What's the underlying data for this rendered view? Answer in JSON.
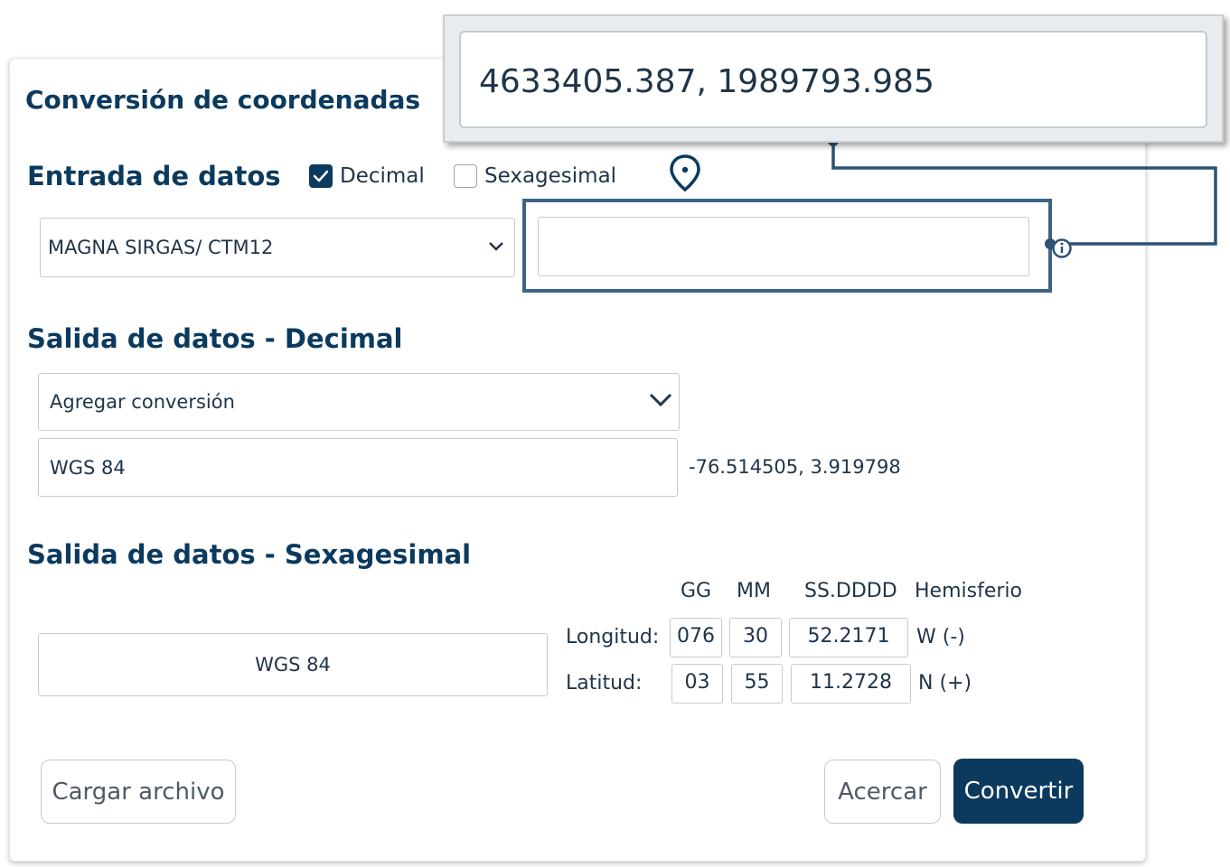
{
  "title": "Conversión de coordenadas",
  "input": {
    "heading": "Entrada de datos",
    "decimal_label": "Decimal",
    "decimal_checked": true,
    "sexagesimal_label": "Sexagesimal",
    "sexagesimal_checked": false,
    "crs_selected": "MAGNA SIRGAS/ CTM12",
    "coordinates_value": "",
    "location_icon": "map-pin-icon",
    "info_icon": "info-icon"
  },
  "callout": {
    "value": "4633405.387, 1989793.985"
  },
  "decimal_output": {
    "heading": "Salida de datos - Decimal",
    "add_placeholder": "Agregar conversión",
    "crs": "WGS 84",
    "result": "-76.514505, 3.919798"
  },
  "sexagesimal_output": {
    "heading": "Salida de datos - Sexagesimal",
    "crs": "WGS 84",
    "columns": [
      "GG",
      "MM",
      "SS.DDDD",
      "Hemisferio"
    ],
    "rows": [
      {
        "label": "Longitud:",
        "gg": "076",
        "mm": "30",
        "ss": "52.2171",
        "hemisphere": "W (-)"
      },
      {
        "label": "Latitud:",
        "gg": "03",
        "mm": "55",
        "ss": "11.2728",
        "hemisphere": "N (+)"
      }
    ]
  },
  "buttons": {
    "load_file": "Cargar archivo",
    "zoom": "Acercar",
    "convert": "Convertir"
  },
  "colors": {
    "primary": "#0b3a5e",
    "highlight": "#3d6387"
  }
}
